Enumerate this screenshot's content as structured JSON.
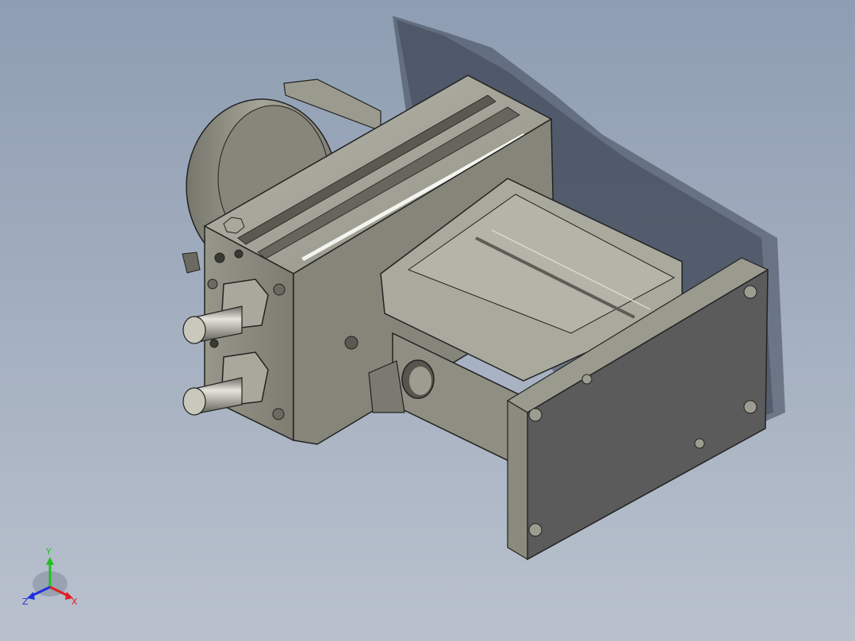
{
  "viewport": {
    "background_top": "#8e9db2",
    "background_bottom": "#b9c1cd",
    "model_color": "#8c8c80",
    "plate_color": "#5a5a5a"
  },
  "triad": {
    "x_label": "X",
    "y_label": "Y",
    "z_label": "Z",
    "x_color": "#e02020",
    "y_color": "#20c020",
    "z_color": "#2030e0"
  }
}
